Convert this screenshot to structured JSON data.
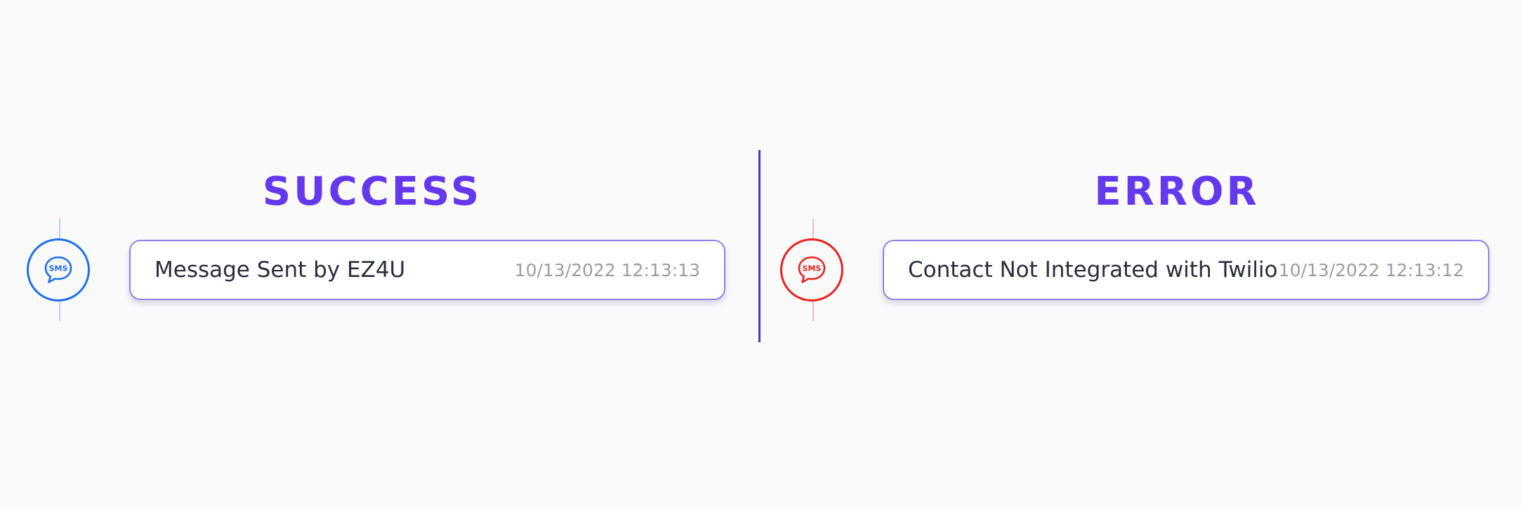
{
  "success": {
    "title": "SUCCESS",
    "icon": "sms-icon",
    "icon_text": "SMS",
    "icon_color": "#1f6fe8",
    "line_color": "#b8cdf6",
    "message": "Message Sent by EZ4U",
    "timestamp": "10/13/2022 12:13:13"
  },
  "error": {
    "title": "ERROR",
    "icon": "sms-icon",
    "icon_text": "SMS",
    "icon_color": "#e8221f",
    "line_color": "#f4b8b8",
    "message": "Contact Not Integrated with Twilio",
    "timestamp": "10/13/2022 12:13:12"
  },
  "colors": {
    "title": "#6438ec",
    "divider": "#4536cf",
    "card_border": "#8f82e6"
  }
}
